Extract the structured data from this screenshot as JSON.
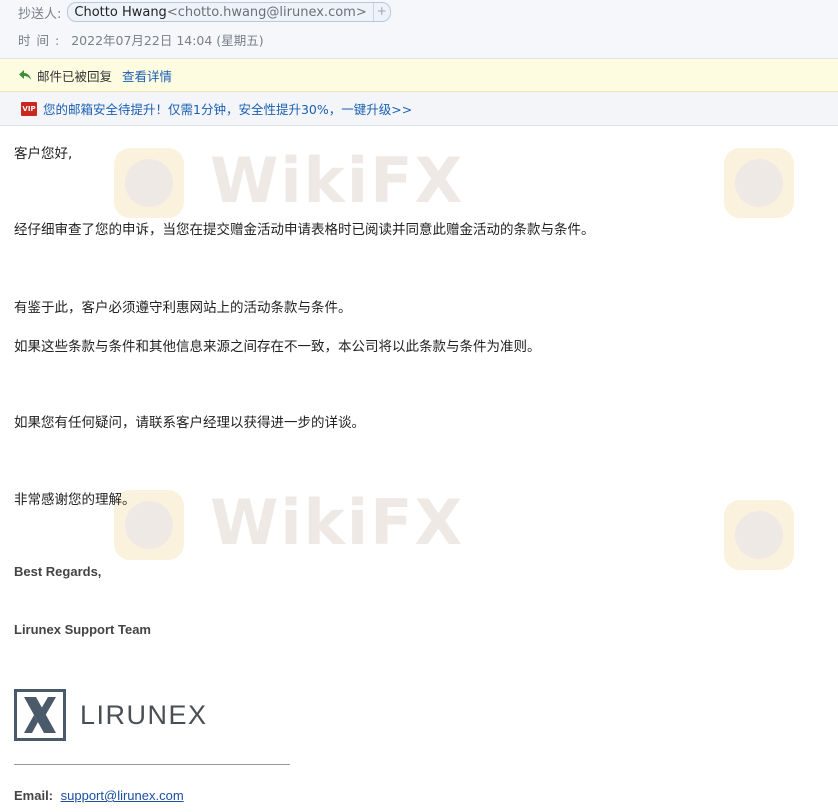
{
  "header": {
    "cc_label": "抄送人:",
    "cc_name": "Chotto Hwang",
    "cc_email": "<chotto.hwang@lirunex.com>",
    "cc_add": "+",
    "time_label": "时间:",
    "time_value": "2022年07月22日 14:04 (星期五)"
  },
  "replied_bar": {
    "text": "邮件已被回复",
    "link": "查看详情"
  },
  "security_bar": {
    "badge": "VIP",
    "text": "您的邮箱安全待提升！仅需1分钟，安全性提升30%，一键升级>>"
  },
  "body": {
    "greeting": "客户您好,",
    "p1": "经仔细审查了您的申诉，当您在提交赠金活动申请表格时已阅读并同意此赠金活动的条款与条件。",
    "p2": "有鉴于此，客户必须遵守利惠网站上的活动条款与条件。",
    "p3": "如果这些条款与条件和其他信息来源之间存在不一致，本公司将以此条款与条件为准则。",
    "p4": "如果您有任何疑问，请联系客户经理以获得进一步的详谈。",
    "p5": "非常感谢您的理解。"
  },
  "signature": {
    "regards": "Best Regards,",
    "team": "Lirunex Support Team",
    "logo_text": "LIRUNEX",
    "email_label": "Email:",
    "email_value": "support@lirunex.com"
  },
  "watermark": {
    "text": "WikiFX"
  },
  "colors": {
    "link": "#1a5fb4",
    "replied_bg": "#fdfbe0",
    "header_bg": "#f5f7fb",
    "logo_slate": "#4a5a6a"
  }
}
